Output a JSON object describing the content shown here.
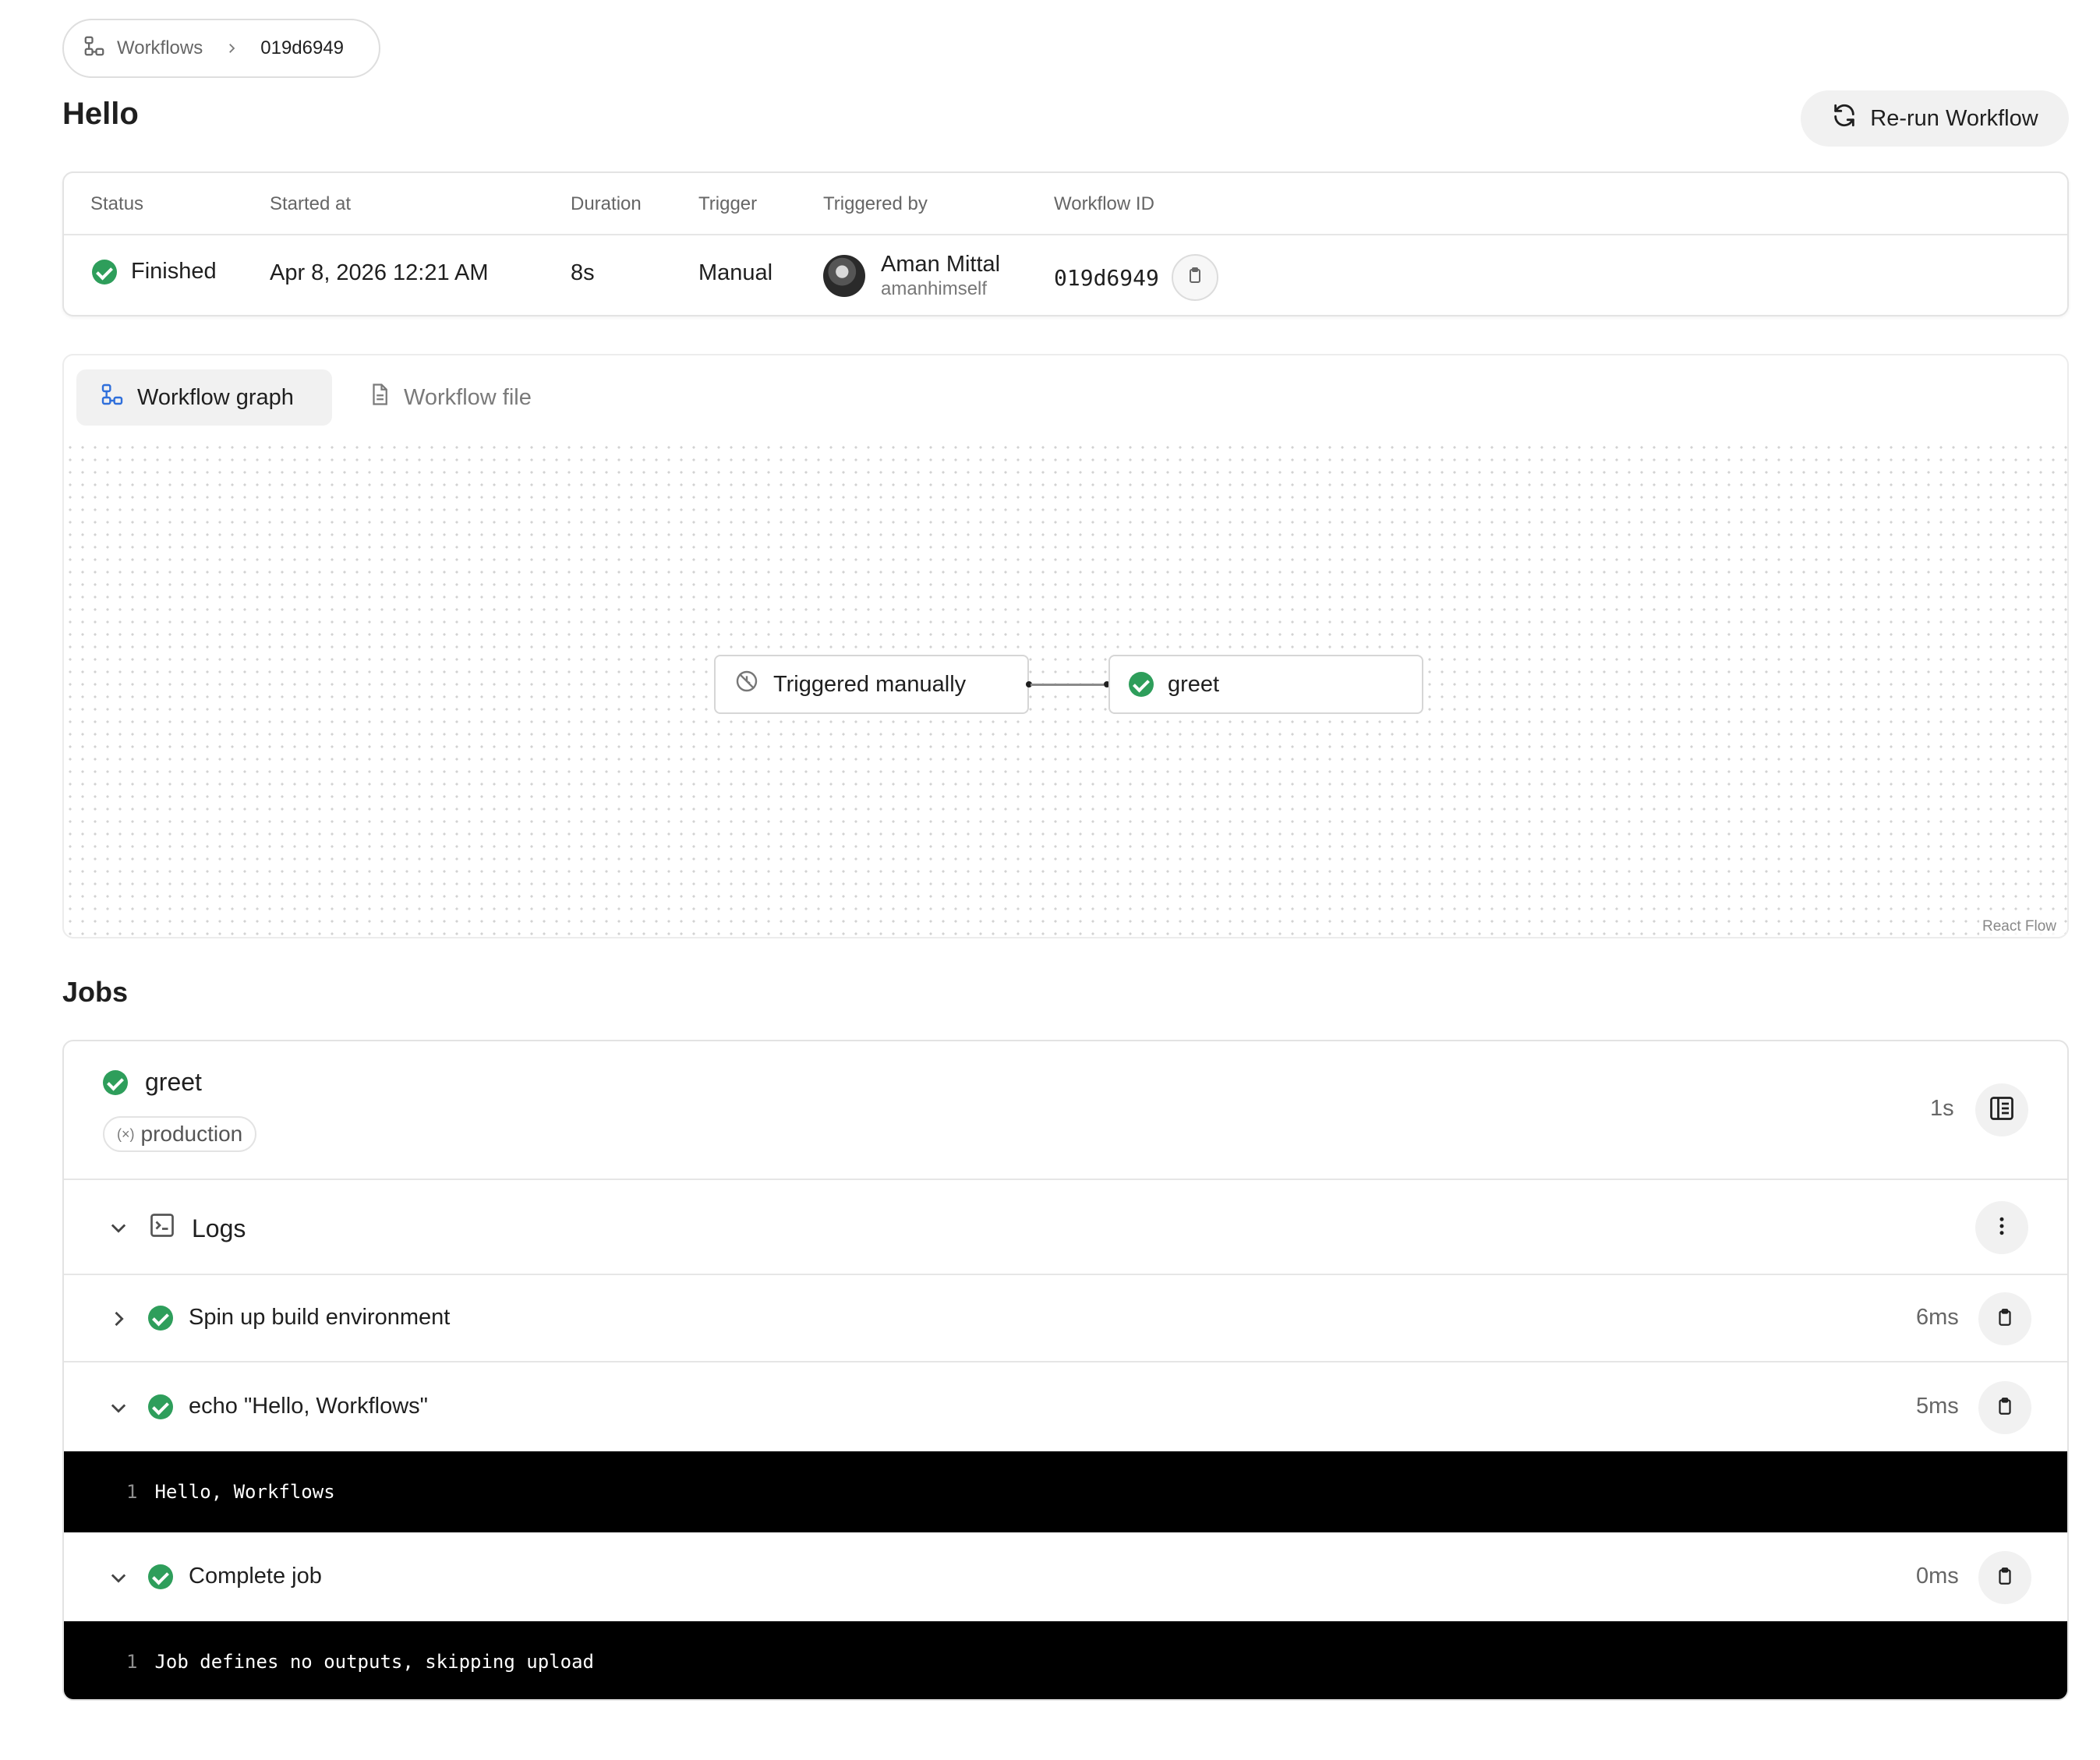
{
  "breadcrumb": {
    "parent": "Workflows",
    "current": "019d6949"
  },
  "page": {
    "title": "Hello",
    "rerun_label": "Re-run Workflow"
  },
  "summary": {
    "headers": {
      "status": "Status",
      "started_at": "Started at",
      "duration": "Duration",
      "trigger": "Trigger",
      "triggered_by": "Triggered by",
      "workflow_id": "Workflow ID"
    },
    "values": {
      "status": "Finished",
      "started_at": "Apr 8, 2026 12:21 AM",
      "duration": "8s",
      "trigger": "Manual",
      "user_name": "Aman Mittal",
      "user_handle": "amanhimself",
      "workflow_id": "019d6949"
    }
  },
  "graph": {
    "tabs": {
      "graph": "Workflow graph",
      "file": "Workflow file"
    },
    "nodes": {
      "trigger": "Triggered manually",
      "job": "greet"
    },
    "attribution": "React Flow"
  },
  "jobs": {
    "title": "Jobs",
    "job": {
      "name": "greet",
      "environment": "production",
      "duration": "1s"
    },
    "logs_label": "Logs",
    "steps": [
      {
        "name": "Spin up build environment",
        "duration": "6ms",
        "expanded": false,
        "output": []
      },
      {
        "name": "echo \"Hello, Workflows\"",
        "duration": "5ms",
        "expanded": true,
        "output": [
          {
            "line": "1",
            "text": "Hello, Workflows"
          }
        ]
      },
      {
        "name": "Complete job",
        "duration": "0ms",
        "expanded": true,
        "output": [
          {
            "line": "1",
            "text": "Job defines no outputs, skipping upload"
          }
        ]
      }
    ]
  },
  "colors": {
    "success": "#2e9e5b",
    "accent_icon": "#2f6fdb",
    "terminal_bg": "#000000"
  },
  "icons": {
    "workflow": "workflow-graph-icon",
    "file": "file-icon",
    "refresh": "refresh-icon",
    "clipboard": "clipboard-icon",
    "terminal": "terminal-icon",
    "more": "more-vertical-icon",
    "logs_panel": "logs-panel-icon",
    "manual_trigger": "manual-trigger-icon",
    "variable": "variable-icon"
  }
}
